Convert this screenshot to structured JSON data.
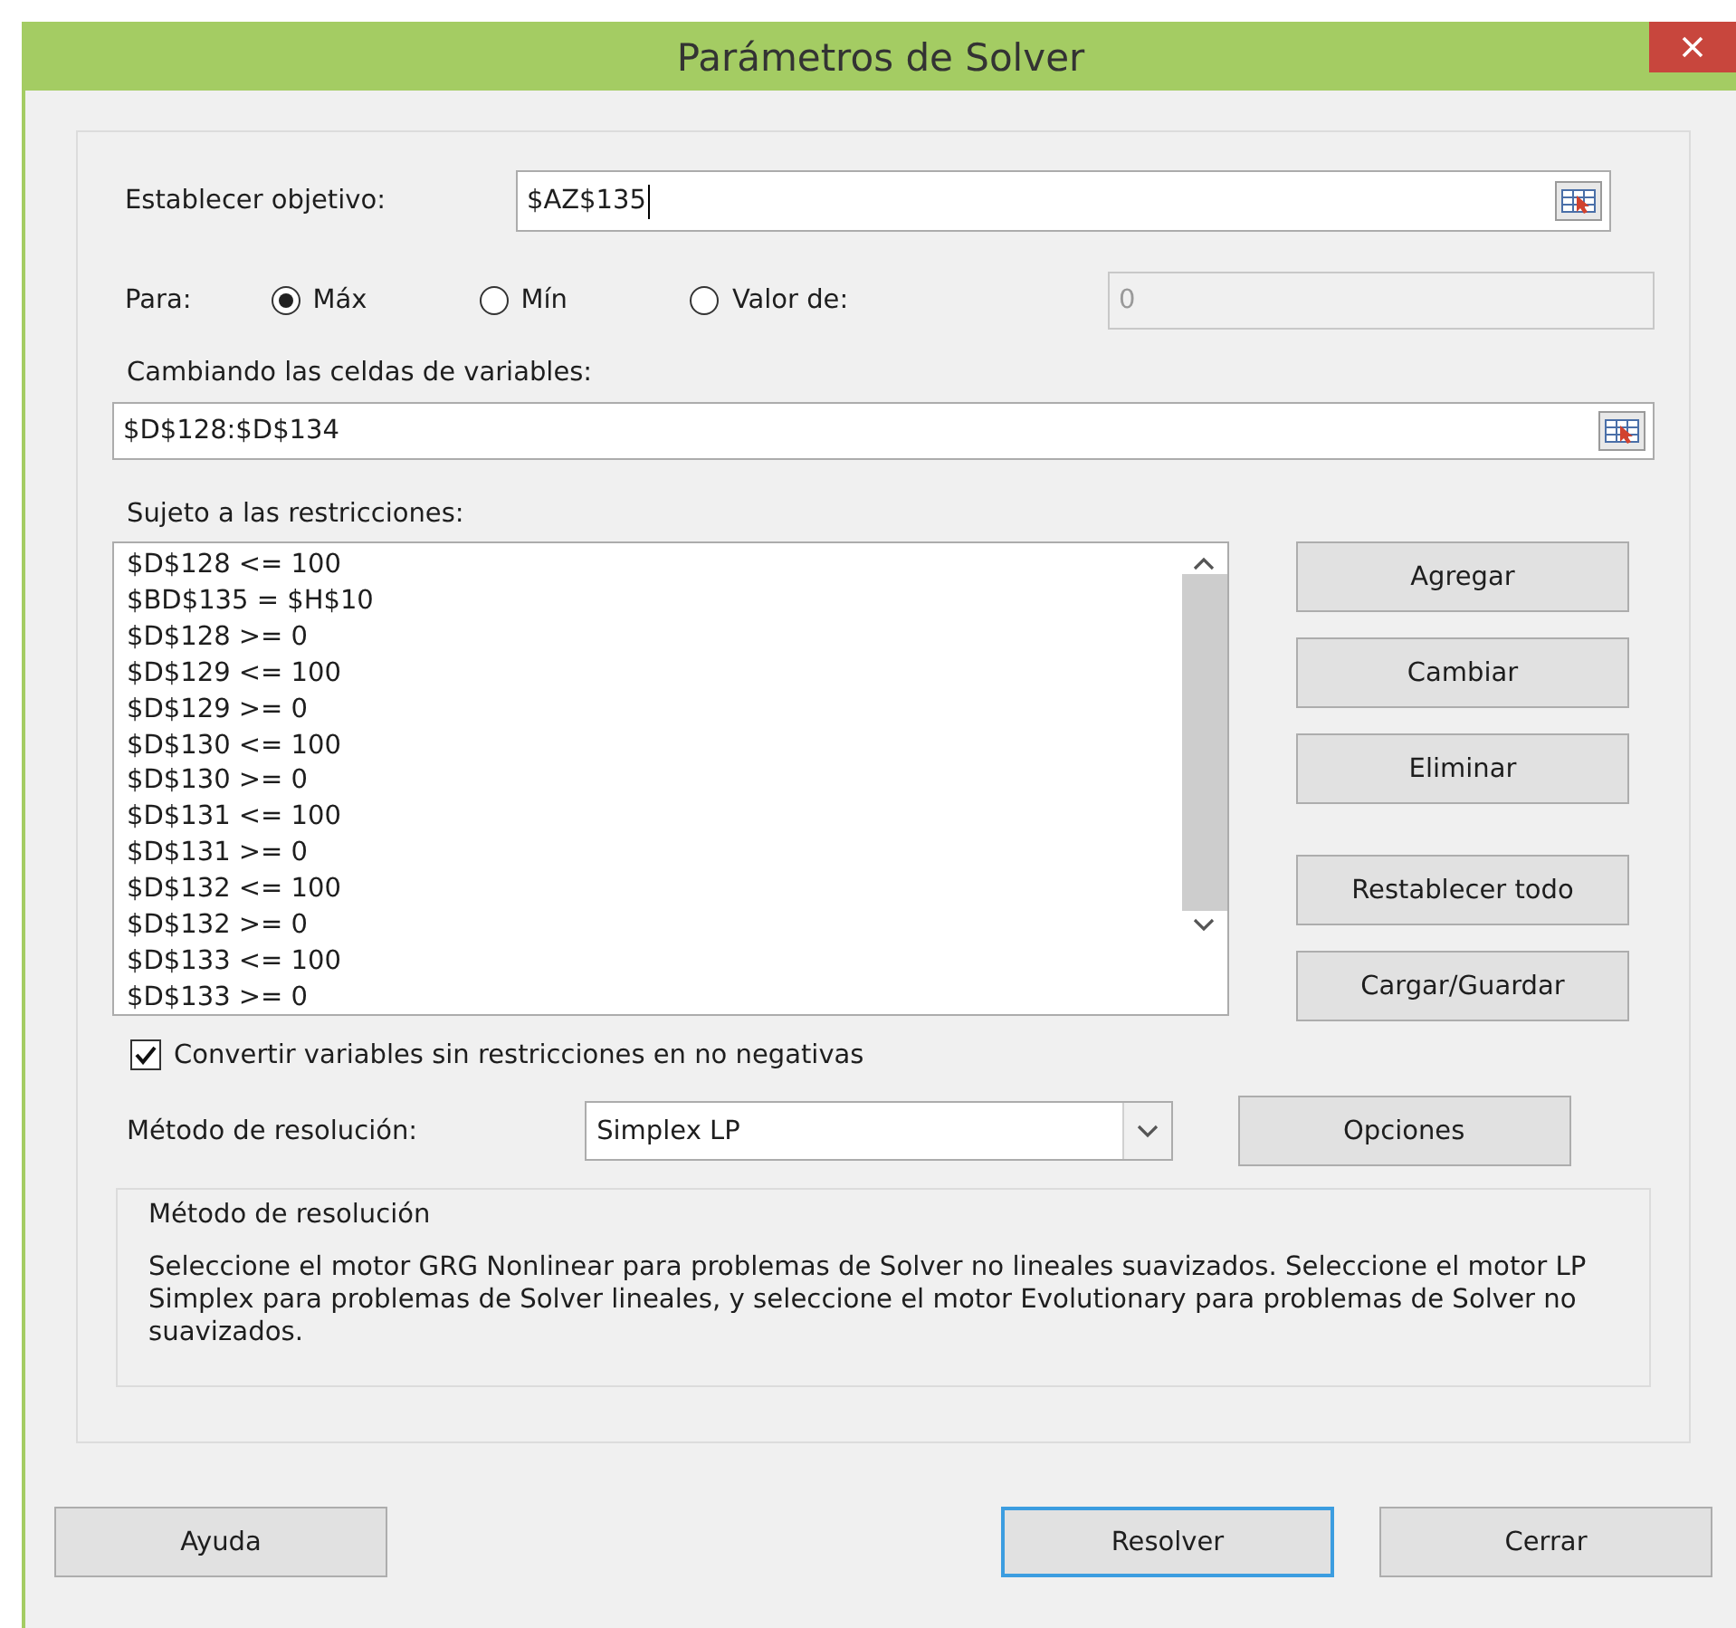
{
  "window": {
    "title": "Parámetros de Solver"
  },
  "objective": {
    "label": "Establecer objetivo:",
    "value": "$AZ$135",
    "focused": true
  },
  "target": {
    "label": "Para:",
    "options": [
      {
        "label": "Máx",
        "selected": true
      },
      {
        "label": "Mín",
        "selected": false
      },
      {
        "label": "Valor de:",
        "selected": false
      }
    ],
    "value_field": {
      "value": "0",
      "disabled": true
    }
  },
  "variables": {
    "label": "Cambiando las celdas de variables:",
    "value": "$D$128:$D$134"
  },
  "constraints": {
    "label": "Sujeto a las restricciones:",
    "items": [
      "$D$128 <= 100",
      "$BD$135 = $H$10",
      "$D$128 >= 0",
      "$D$129 <= 100",
      "$D$129 >= 0",
      "$D$130 <= 100",
      "$D$130 >= 0",
      "$D$131 <= 100",
      "$D$131 >= 0",
      "$D$132 <= 100",
      "$D$132 >= 0",
      "$D$133 <= 100",
      "$D$133 >= 0"
    ]
  },
  "side_buttons": [
    "Agregar",
    "Cambiar",
    "Eliminar",
    "Restablecer todo",
    "Cargar/Guardar"
  ],
  "nonnegative": {
    "label": "Convertir variables sin restricciones en no negativas",
    "checked": true
  },
  "method": {
    "label": "Método de resolución:",
    "value": "Simplex LP",
    "button": "Opciones"
  },
  "info": {
    "title": "Método de resolución",
    "text": "Seleccione el motor GRG Nonlinear para problemas de Solver no lineales suavizados. Seleccione el motor LP Simplex para problemas de Solver lineales, y seleccione el motor Evolutionary para problemas de Solver no suavizados."
  },
  "footer_buttons": [
    {
      "label": "Ayuda",
      "default": false
    },
    {
      "label": "Resolver",
      "default": true
    },
    {
      "label": "Cerrar",
      "default": false
    }
  ]
}
